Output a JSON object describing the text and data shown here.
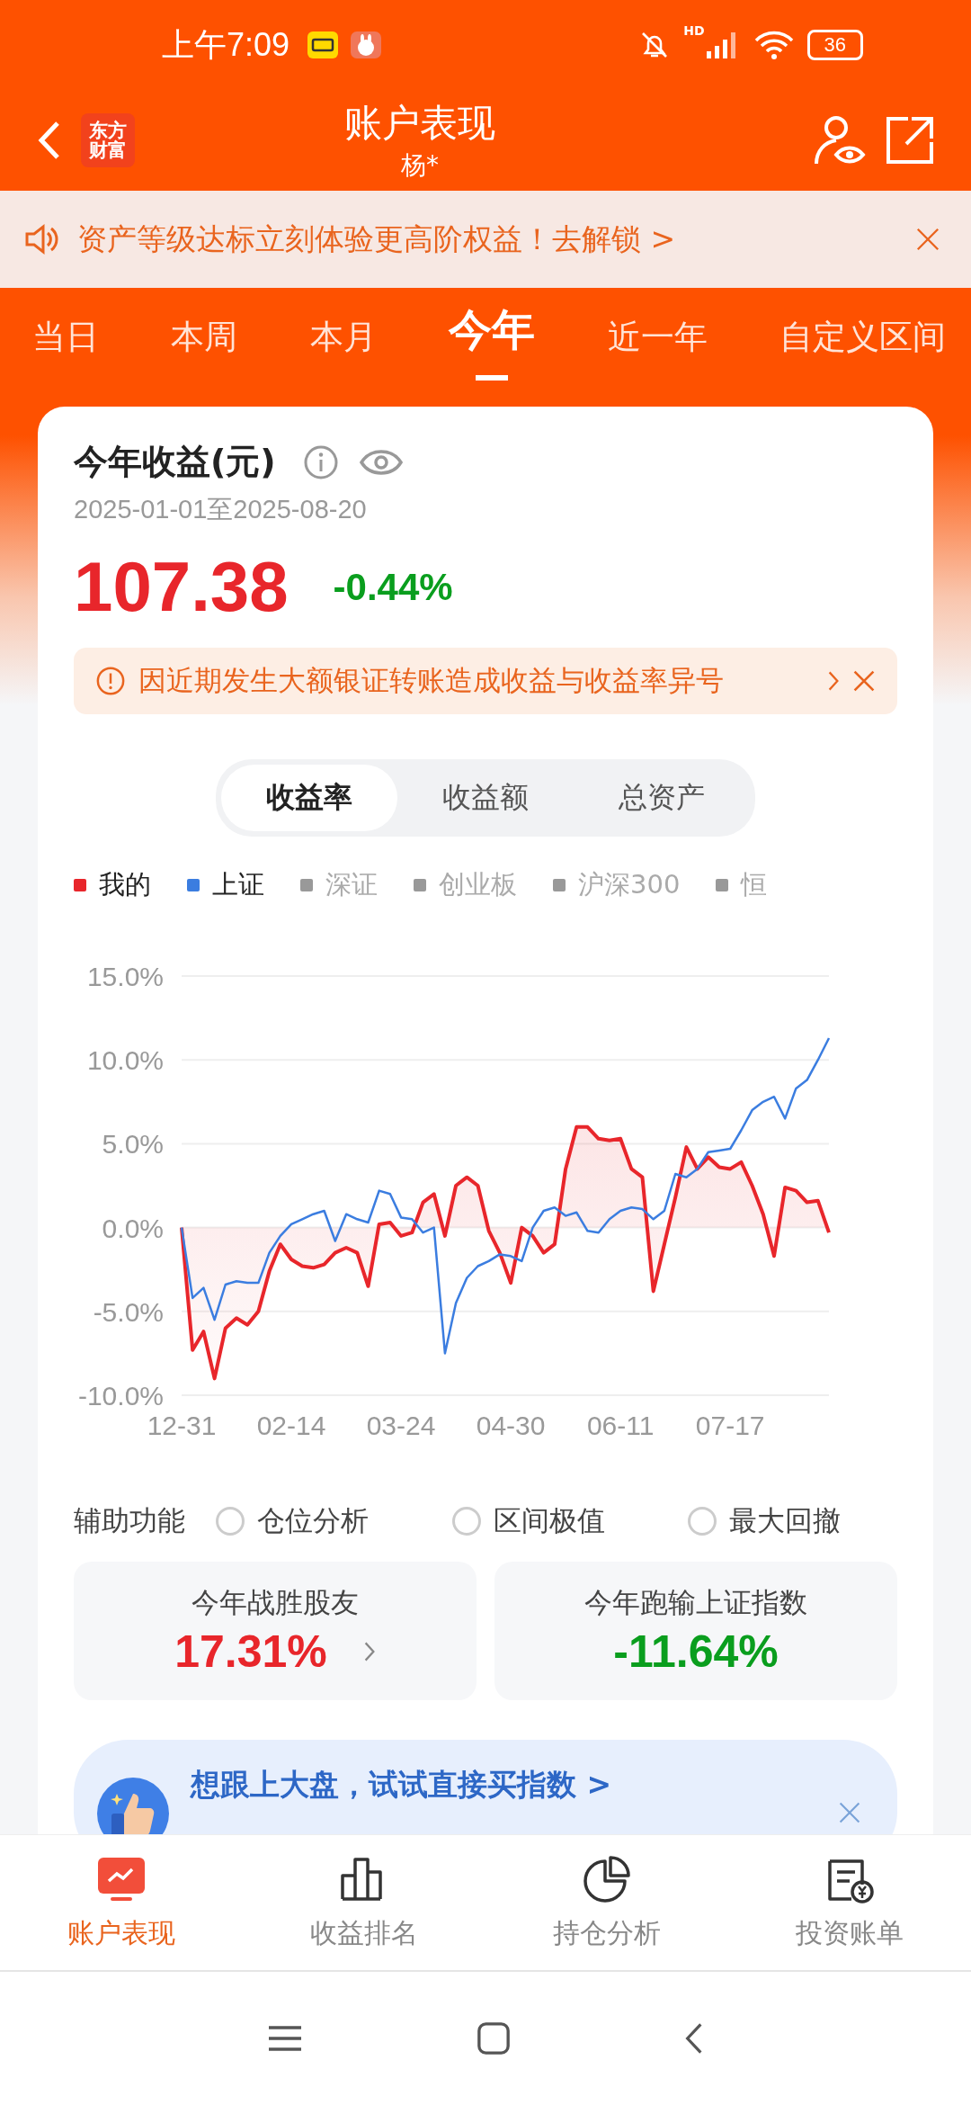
{
  "status_bar": {
    "time": "上午7:09",
    "network": "HD",
    "battery": "36"
  },
  "header": {
    "logo_lines": [
      "东方",
      "财富"
    ],
    "title": "账户表现",
    "subtitle": "杨*"
  },
  "banner": {
    "text": "资产等级达标立刻体验更高阶权益！去解锁 >"
  },
  "tabs": [
    {
      "label": "当日",
      "selected": false
    },
    {
      "label": "本周",
      "selected": false
    },
    {
      "label": "本月",
      "selected": false
    },
    {
      "label": "今年",
      "selected": true
    },
    {
      "label": "近一年",
      "selected": false
    },
    {
      "label": "自定义区间",
      "selected": false
    }
  ],
  "summary": {
    "title": "今年收益(元)",
    "date_range": "2025-01-01至2025-08-20",
    "amount": "107.38",
    "rate": "-0.44%",
    "notice": "因近期发生大额银证转账造成收益与收益率异号"
  },
  "chart_tabs": [
    {
      "label": "收益率",
      "selected": true
    },
    {
      "label": "收益额",
      "selected": false
    },
    {
      "label": "总资产",
      "selected": false
    }
  ],
  "chart": {
    "legend": [
      {
        "label": "我的",
        "color": "#e8262b",
        "selected": true
      },
      {
        "label": "上证",
        "color": "#3b7de0",
        "selected": true
      },
      {
        "label": "深证",
        "color": "#999999",
        "selected": false
      },
      {
        "label": "创业板",
        "color": "#999999",
        "selected": false
      },
      {
        "label": "沪深300",
        "color": "#999999",
        "selected": false
      },
      {
        "label": "恒",
        "color": "#999999",
        "selected": false
      }
    ],
    "chart_data": {
      "type": "line",
      "categories": [
        "12-31",
        null,
        null,
        null,
        null,
        null,
        null,
        null,
        null,
        null,
        "02-14",
        null,
        null,
        null,
        null,
        null,
        null,
        null,
        null,
        null,
        "03-24",
        null,
        null,
        null,
        null,
        null,
        null,
        null,
        null,
        null,
        "04-30",
        null,
        null,
        null,
        null,
        null,
        null,
        null,
        null,
        null,
        "06-11",
        null,
        null,
        null,
        null,
        null,
        null,
        null,
        null,
        null,
        "07-17",
        null,
        null,
        null,
        null,
        null,
        null,
        null,
        null,
        null
      ],
      "series": [
        {
          "type": "area",
          "color": "#e8262b",
          "values": [
            0,
            -7.3,
            -6.2,
            -9.0,
            -6.0,
            -5.4,
            -5.8,
            -5.0,
            -2.6,
            -1.0,
            -1.9,
            -2.3,
            -2.4,
            -2.2,
            -1.5,
            -1.2,
            -1.5,
            -3.5,
            0.2,
            0.3,
            -0.5,
            -0.3,
            1.5,
            2.0,
            -0.5,
            2.5,
            3.0,
            2.5,
            -0.2,
            -1.5,
            -3.3,
            0.0,
            -0.5,
            -1.5,
            -1.0,
            3.5,
            6.0,
            6.0,
            5.3,
            5.2,
            5.3,
            3.5,
            3.0,
            -3.8,
            -1.0,
            1.8,
            4.8,
            3.5,
            4.2,
            3.6,
            3.5,
            3.9,
            2.5,
            0.8,
            -1.7,
            2.4,
            2.2,
            1.5,
            1.6,
            -0.3
          ]
        },
        {
          "type": "line",
          "color": "#3b7de0",
          "values": [
            0,
            -4.2,
            -3.6,
            -5.5,
            -3.4,
            -3.2,
            -3.3,
            -3.3,
            -1.5,
            -0.5,
            0.2,
            0.5,
            0.8,
            1.0,
            -0.8,
            0.8,
            0.5,
            0.3,
            2.2,
            2.0,
            0.6,
            0.5,
            -0.3,
            0.0,
            -7.5,
            -4.5,
            -3.0,
            -2.3,
            -2.0,
            -1.6,
            -1.7,
            -2.0,
            0.0,
            1.0,
            1.2,
            0.7,
            0.9,
            -0.2,
            -0.3,
            0.5,
            1.0,
            1.2,
            1.1,
            0.5,
            1.0,
            3.2,
            3.0,
            3.5,
            4.5,
            4.6,
            4.7,
            5.8,
            7.0,
            7.5,
            7.8,
            6.5,
            8.3,
            8.8,
            10.0,
            11.3
          ]
        }
      ],
      "ylim": [
        -10,
        15
      ],
      "grid": true,
      "yticks": [
        {
          "value": 15,
          "label": "15.0%"
        },
        {
          "value": 10,
          "label": "10.0%"
        },
        {
          "value": 5,
          "label": "5.0%"
        },
        {
          "value": 0,
          "label": "0.0%"
        },
        {
          "value": -5,
          "label": "-5.0%"
        },
        {
          "value": -10,
          "label": "-10.0%"
        }
      ]
    }
  },
  "aux": {
    "label": "辅助功能",
    "options": [
      {
        "label": "仓位分析",
        "checked": false
      },
      {
        "label": "区间极值",
        "checked": false
      },
      {
        "label": "最大回撤",
        "checked": false
      }
    ]
  },
  "stats": [
    {
      "label": "今年战胜股友",
      "value": "17.31%",
      "color": "#e8262b",
      "link": true
    },
    {
      "label": "今年跑输上证指数",
      "value": "-11.64%",
      "color": "#0a9e1e",
      "link": false
    }
  ],
  "promo": {
    "title": "想跟上大盘，试试直接买指数 >"
  },
  "bottom_nav": [
    {
      "label": "账户表现",
      "selected": true,
      "kind": "chart"
    },
    {
      "label": "收益排名",
      "selected": false,
      "kind": "bars"
    },
    {
      "label": "持仓分析",
      "selected": false,
      "kind": "pie"
    },
    {
      "label": "投资账单",
      "selected": false,
      "kind": "bill"
    }
  ]
}
